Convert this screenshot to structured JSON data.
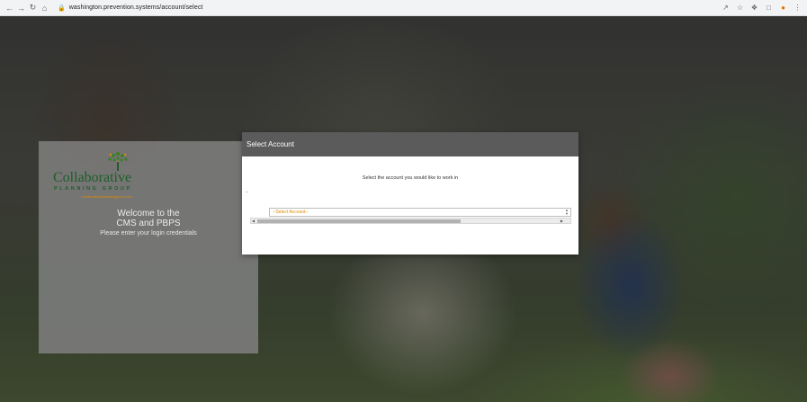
{
  "browser": {
    "url": "washington.prevention.systems/account/select",
    "nav_icons": [
      "back-arrow-icon",
      "forward-arrow-icon",
      "reload-icon",
      "home-icon"
    ],
    "toolbar_icons": [
      "share-icon",
      "star-icon",
      "puzzle-icon",
      "sidebar-icon",
      "extension-icon",
      "menu-icon"
    ]
  },
  "login": {
    "logo_text": "Collaborative",
    "logo_subtitle": "PLANNING GROUP",
    "logo_url": "collaborativeplanninggroup.com",
    "welcome_line1": "Welcome to the",
    "welcome_line2": "CMS and PBPS",
    "instruction": "Please enter your login credentials"
  },
  "modal": {
    "title": "Select Account",
    "instruction": "Select the account you would like to work in",
    "select_value": "--Select Account--"
  },
  "colors": {
    "modal_header": "#5b5b5b",
    "logo_green": "#1d5e2a",
    "accent_orange": "#e08a00"
  }
}
